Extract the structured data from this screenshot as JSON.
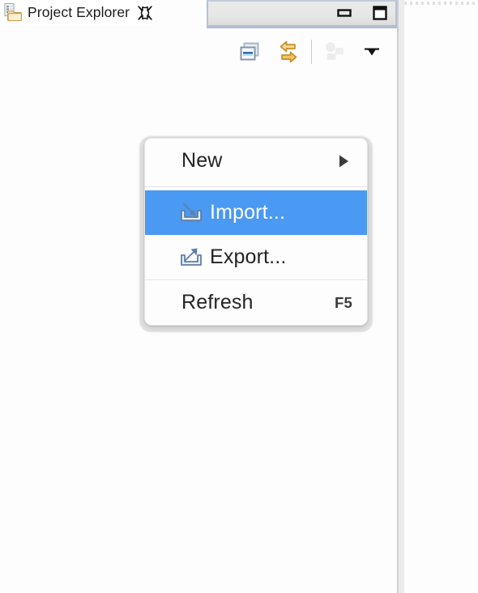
{
  "view": {
    "tab": {
      "icon": "project-explorer-icon",
      "title": "Project Explorer",
      "close_icon": "close-icon",
      "close_label": "Close"
    },
    "window_buttons": [
      {
        "name": "minimize-button",
        "icon": "minimize-icon",
        "label": "Minimize"
      },
      {
        "name": "maximize-button",
        "icon": "maximize-icon",
        "label": "Maximize"
      }
    ],
    "toolbar": [
      {
        "name": "collapse-all-button",
        "icon": "collapse-all-icon",
        "label": "Collapse All",
        "enabled": true
      },
      {
        "name": "link-with-editor-button",
        "icon": "link-with-editor-icon",
        "label": "Link with Editor",
        "enabled": true
      },
      {
        "name": "separator",
        "icon": "separator",
        "label": "",
        "enabled": true
      },
      {
        "name": "focus-active-task-button",
        "icon": "focus-active-task-icon",
        "label": "Focus on Active Task",
        "enabled": false
      },
      {
        "name": "view-menu-button",
        "icon": "chevron-down-icon",
        "label": "View Menu",
        "enabled": true
      }
    ]
  },
  "context_menu": {
    "items": [
      {
        "id": "new",
        "label": "New",
        "icon": null,
        "accelerator": null,
        "submenu": true,
        "selected": false,
        "separator_after": true
      },
      {
        "id": "import",
        "label": "Import...",
        "icon": "import-icon",
        "accelerator": null,
        "submenu": false,
        "selected": true,
        "separator_after": false
      },
      {
        "id": "export",
        "label": "Export...",
        "icon": "export-icon",
        "accelerator": null,
        "submenu": false,
        "selected": false,
        "separator_after": true
      },
      {
        "id": "refresh",
        "label": "Refresh",
        "icon": null,
        "accelerator": "F5",
        "submenu": false,
        "selected": false,
        "separator_after": false
      }
    ]
  },
  "colors": {
    "selection_blue": "#4a99f2",
    "menu_background": "#fdfdfd",
    "menu_text": "#242424",
    "selected_text": "#ffffff",
    "tab_underline": "#b4bdd2",
    "link_arrow_gold": "#e0a828",
    "folder_gold": "#e8c98a"
  }
}
